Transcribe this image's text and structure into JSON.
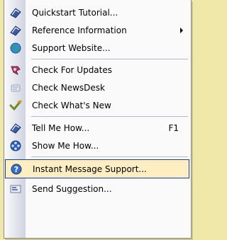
{
  "menu": {
    "items": [
      {
        "label": "Quickstart Tutorial...",
        "icon": "book-icon"
      },
      {
        "label": "Reference Information",
        "icon": "book-icon",
        "submenu": true
      },
      {
        "label": "Support Website...",
        "icon": "globe-icon"
      },
      {
        "label": "Check For Updates",
        "icon": "update-icon"
      },
      {
        "label": "Check NewsDesk",
        "icon": "newsdesk-icon"
      },
      {
        "label": "Check What's New",
        "icon": "checkmark-icon"
      },
      {
        "label": "Tell Me How...",
        "icon": "book-icon",
        "shortcut": "F1"
      },
      {
        "label": "Show Me How...",
        "icon": "film-reel-icon"
      },
      {
        "label": "Instant Message Support...",
        "icon": "chat-icon",
        "highlighted": true
      },
      {
        "label": "Send Suggestion...",
        "icon": "suggestion-icon"
      }
    ]
  },
  "colors": {
    "background": "#f0e8a8",
    "highlight_fill": "#ffeec2",
    "highlight_border": "#1c3f95"
  }
}
